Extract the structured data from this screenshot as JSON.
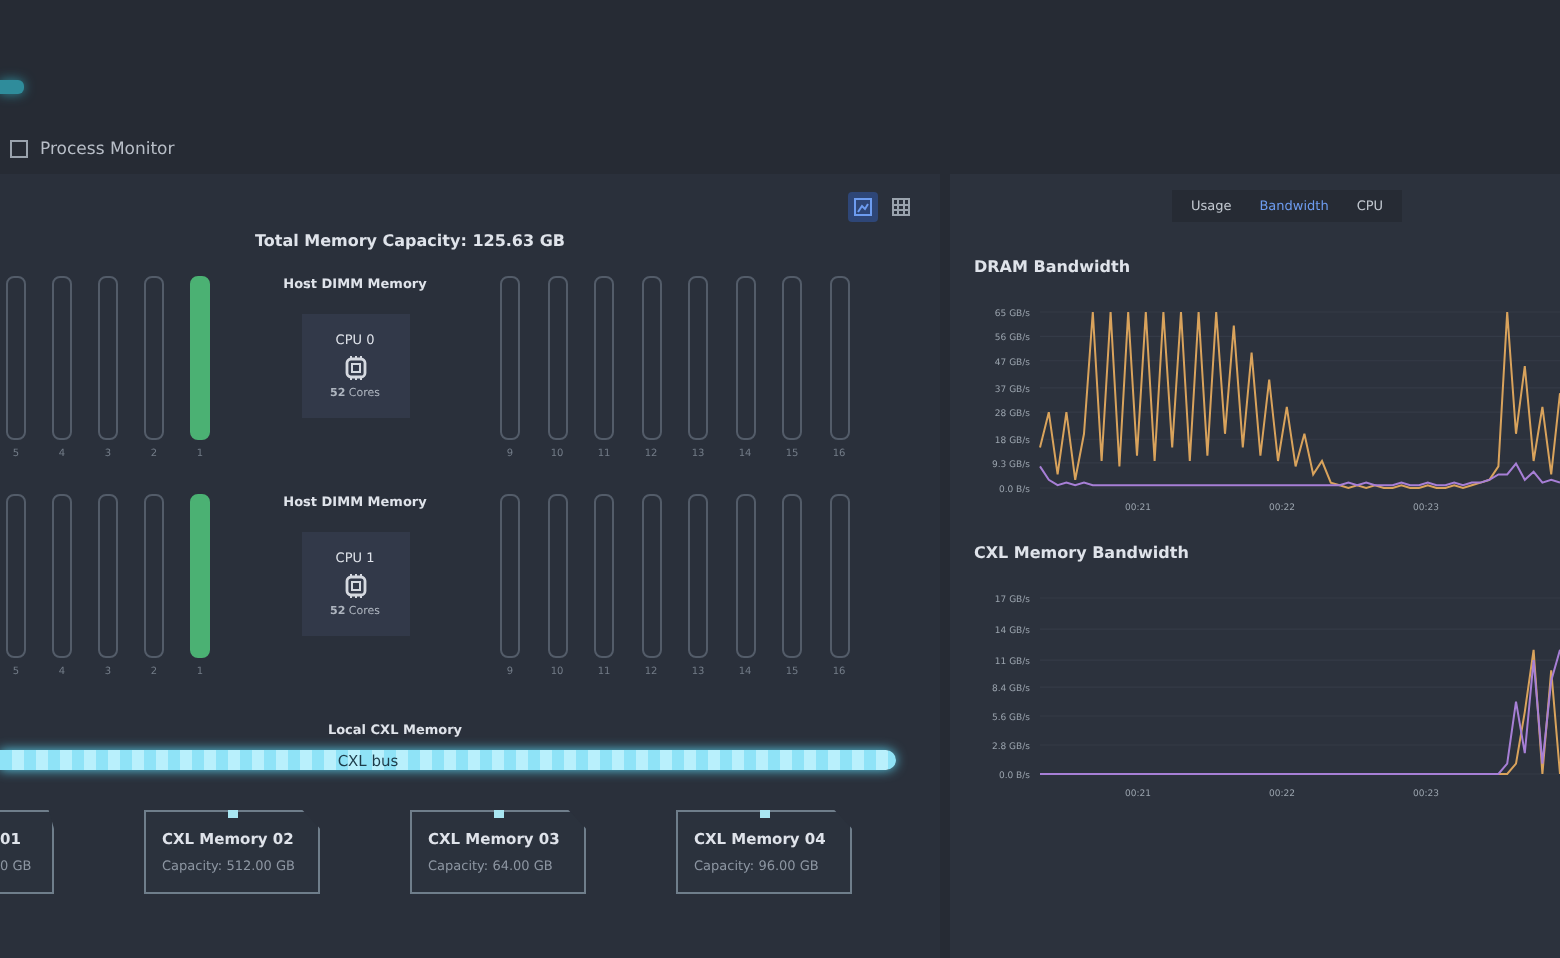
{
  "process_monitor": {
    "label": "Process Monitor",
    "checked": false
  },
  "memory_panel": {
    "view_toggle": [
      {
        "kind": "chart",
        "selected": true
      },
      {
        "kind": "table",
        "selected": false
      }
    ],
    "title": "Total Memory Capacity: 125.63 GB",
    "cpus": [
      {
        "section_label": "Host DIMM Memory",
        "name": "CPU 0",
        "cores": "**52** Cores",
        "slots_left": [
          {
            "label": "5",
            "occupied": false
          },
          {
            "label": "4",
            "occupied": false
          },
          {
            "label": "3",
            "occupied": false
          },
          {
            "label": "2",
            "occupied": false
          },
          {
            "label": "1",
            "occupied": true
          }
        ],
        "slots_right": [
          {
            "label": "9",
            "occupied": false
          },
          {
            "label": "10",
            "occupied": false
          },
          {
            "label": "11",
            "occupied": false
          },
          {
            "label": "12",
            "occupied": false
          },
          {
            "label": "13",
            "occupied": false
          },
          {
            "label": "14",
            "occupied": false
          },
          {
            "label": "15",
            "occupied": false
          },
          {
            "label": "16",
            "occupied": false
          }
        ]
      },
      {
        "section_label": "Host DIMM Memory",
        "name": "CPU 1",
        "cores": "**52** Cores",
        "slots_left": [
          {
            "label": "5",
            "occupied": false
          },
          {
            "label": "4",
            "occupied": false
          },
          {
            "label": "3",
            "occupied": false
          },
          {
            "label": "2",
            "occupied": false
          },
          {
            "label": "1",
            "occupied": true
          }
        ],
        "slots_right": [
          {
            "label": "9",
            "occupied": false
          },
          {
            "label": "10",
            "occupied": false
          },
          {
            "label": "11",
            "occupied": false
          },
          {
            "label": "12",
            "occupied": false
          },
          {
            "label": "13",
            "occupied": false
          },
          {
            "label": "14",
            "occupied": false
          },
          {
            "label": "15",
            "occupied": false
          },
          {
            "label": "16",
            "occupied": false
          }
        ]
      }
    ],
    "cxl_label": "Local CXL Memory",
    "bus_label": "CXL bus",
    "cxl_devices": [
      {
        "name": "01",
        "capacity": "0 GB",
        "cut": true
      },
      {
        "name": "CXL Memory 02",
        "capacity": "Capacity: 512.00 GB",
        "cut": false
      },
      {
        "name": "CXL Memory 03",
        "capacity": "Capacity: 64.00 GB",
        "cut": false
      },
      {
        "name": "CXL Memory 04",
        "capacity": "Capacity: 96.00 GB",
        "cut": false
      }
    ]
  },
  "bandwidth_panel": {
    "tabs": [
      {
        "label": "Usage",
        "selected": false
      },
      {
        "label": "Bandwidth",
        "selected": true
      },
      {
        "label": "CPU",
        "selected": false
      }
    ],
    "charts": [
      {
        "heading": "DRAM Bandwidth",
        "x_labels": [
          "00:21",
          "00:22",
          "00:23"
        ],
        "chart_data": {
          "type": "line",
          "grid": true,
          "ylim": [
            0,
            65
          ],
          "yticks": [
            {
              "value": 0,
              "label": "0.0 B/s"
            },
            {
              "value": 9.3,
              "label": "9.3 GB/s"
            },
            {
              "value": 18,
              "label": "18 GB/s"
            },
            {
              "value": 28,
              "label": "28 GB/s"
            },
            {
              "value": 37,
              "label": "37 GB/s"
            },
            {
              "value": 47,
              "label": "47 GB/s"
            },
            {
              "value": 56,
              "label": "56 GB/s"
            },
            {
              "value": 65,
              "label": "65 GB/s"
            }
          ],
          "series": [
            {
              "color": "#d9a35c",
              "values": [
                15,
                28,
                5,
                28,
                3,
                20,
                65,
                10,
                65,
                8,
                65,
                12,
                65,
                10,
                65,
                15,
                65,
                10,
                65,
                12,
                65,
                20,
                60,
                15,
                50,
                12,
                40,
                10,
                30,
                8,
                20,
                5,
                10,
                2,
                1,
                0,
                1,
                0,
                1,
                0,
                0,
                1,
                0,
                0,
                1,
                0,
                0,
                1,
                0,
                1,
                2,
                3,
                8,
                65,
                20,
                45,
                10,
                30,
                5,
                35
              ]
            },
            {
              "color": "#a77fd6",
              "values": [
                8,
                3,
                1,
                2,
                1,
                2,
                1,
                1,
                1,
                1,
                1,
                1,
                1,
                1,
                1,
                1,
                1,
                1,
                1,
                1,
                1,
                1,
                1,
                1,
                1,
                1,
                1,
                1,
                1,
                1,
                1,
                1,
                1,
                1,
                1,
                2,
                1,
                2,
                1,
                1,
                1,
                2,
                1,
                1,
                2,
                1,
                1,
                2,
                1,
                2,
                2,
                3,
                5,
                5,
                9,
                3,
                6,
                2,
                3,
                2
              ]
            }
          ]
        }
      },
      {
        "heading": "CXL Memory Bandwidth",
        "x_labels": [
          "00:21",
          "00:22",
          "00:23"
        ],
        "chart_data": {
          "type": "line",
          "grid": true,
          "ylim": [
            0,
            17
          ],
          "yticks": [
            {
              "value": 0,
              "label": "0.0 B/s"
            },
            {
              "value": 2.8,
              "label": "2.8 GB/s"
            },
            {
              "value": 5.6,
              "label": "5.6 GB/s"
            },
            {
              "value": 8.4,
              "label": "8.4 GB/s"
            },
            {
              "value": 11,
              "label": "11 GB/s"
            },
            {
              "value": 14,
              "label": "14 GB/s"
            },
            {
              "value": 17,
              "label": "17 GB/s"
            }
          ],
          "series": [
            {
              "color": "#d9a35c",
              "values": [
                null,
                null,
                null,
                null,
                null,
                null,
                null,
                null,
                null,
                null,
                null,
                null,
                null,
                null,
                null,
                null,
                null,
                null,
                null,
                null,
                null,
                null,
                null,
                null,
                null,
                null,
                null,
                null,
                null,
                null,
                null,
                null,
                null,
                null,
                null,
                null,
                null,
                null,
                null,
                null,
                null,
                null,
                null,
                null,
                null,
                null,
                null,
                null,
                null,
                null,
                null,
                null,
                0,
                0,
                1,
                6,
                12,
                0,
                10,
                0
              ]
            },
            {
              "color": "#a77fd6",
              "values": [
                0,
                0,
                0,
                0,
                0,
                0,
                0,
                0,
                0,
                0,
                0,
                0,
                0,
                0,
                0,
                0,
                0,
                0,
                0,
                0,
                0,
                0,
                0,
                0,
                0,
                0,
                0,
                0,
                0,
                0,
                0,
                0,
                0,
                0,
                0,
                0,
                0,
                0,
                0,
                0,
                0,
                0,
                0,
                0,
                0,
                0,
                0,
                0,
                0,
                0,
                0,
                0,
                0,
                1,
                7,
                2,
                11,
                1,
                9,
                12
              ]
            }
          ]
        }
      }
    ]
  }
}
